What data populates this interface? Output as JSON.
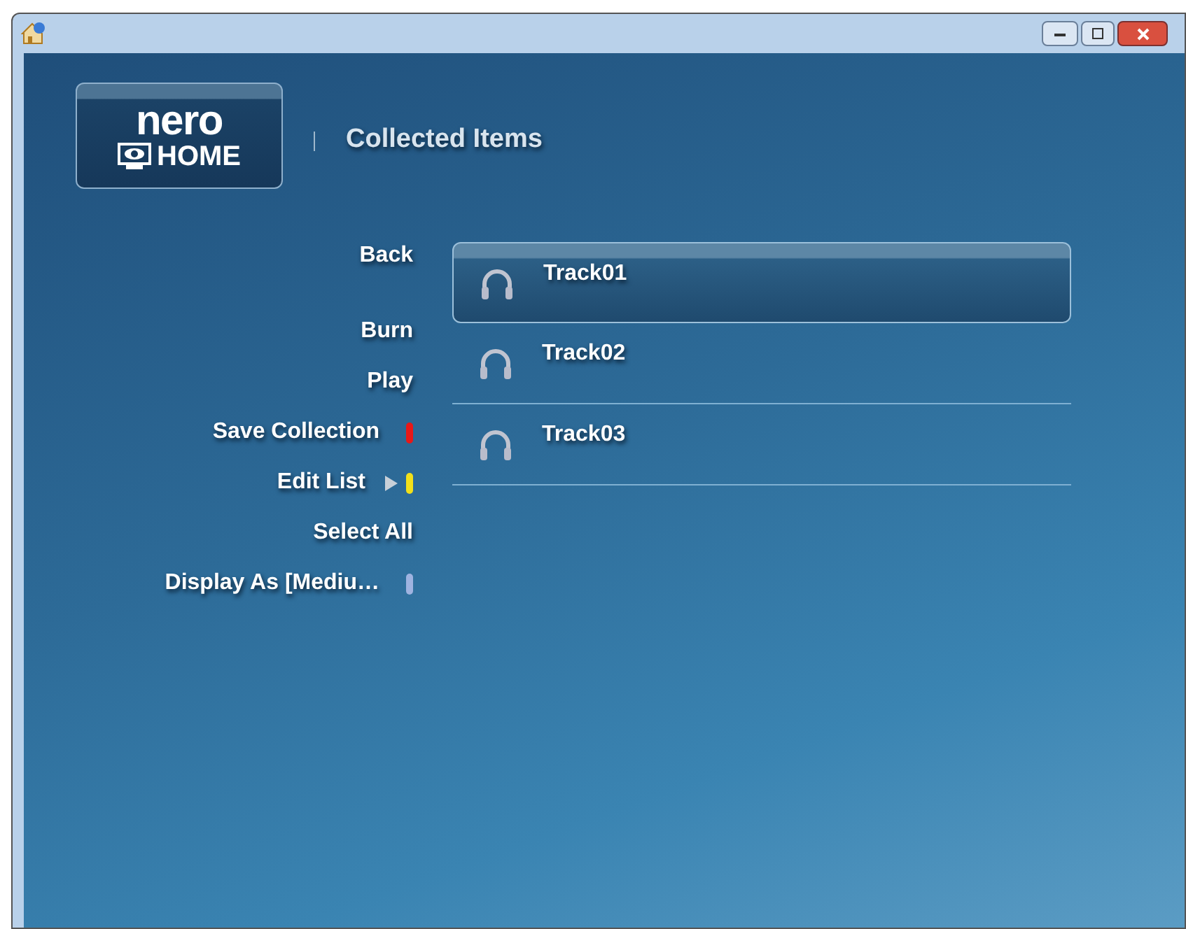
{
  "logo": {
    "top": "nero",
    "bottom": "HOME"
  },
  "page_title": "Collected Items",
  "menu": [
    {
      "label": "Back",
      "submenu": false
    },
    {
      "label": "Burn",
      "submenu": false
    },
    {
      "label": "Play",
      "submenu": false
    },
    {
      "label": "Save Collection",
      "color": "#e81818",
      "submenu": false
    },
    {
      "label": "Edit List",
      "color": "#f2e01a",
      "submenu": true
    },
    {
      "label": "Select All",
      "submenu": false
    },
    {
      "label": "Display As [Mediu…",
      "color": "#9fb3e0",
      "submenu": false
    }
  ],
  "tracks": [
    {
      "label": "Track01",
      "selected": true
    },
    {
      "label": "Track02",
      "selected": false
    },
    {
      "label": "Track03",
      "selected": false
    }
  ]
}
